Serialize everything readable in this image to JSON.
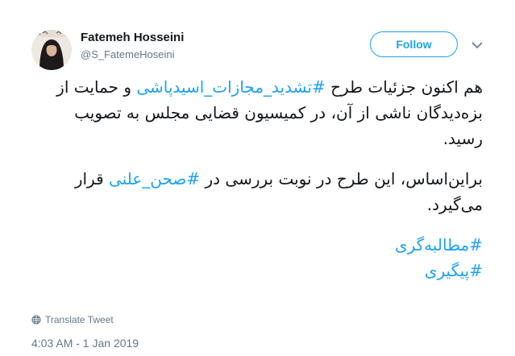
{
  "tweet": {
    "author_name": "Fatemeh Hosseini",
    "author_handle": "@S_FatemeHoseini",
    "follow_label": "Follow",
    "paragraph1": {
      "pre": "هم اکنون جزئیات طرح ",
      "hashtag": "#تشدید_مجازات_اسیدپاشی",
      "post": " و حمایت از بزه‌دیدگان ناشی از آن، در کمیسیون قضایی مجلس به تصویب رسید."
    },
    "paragraph2": {
      "pre": "براین‌اساس، این طرح در نوبت بررسی در ",
      "hashtag": "#صحن_علنی",
      "post": " قرار می‌گیرد."
    },
    "hashtags_end": [
      "#مطالبه‌گری",
      "#پیگیری"
    ],
    "translate_label": "Translate Tweet",
    "timestamp": "4:03 AM - 1 Jan 2019"
  },
  "colors": {
    "accent": "#1da1f2",
    "secondary_text": "#657786",
    "primary_text": "#14171a"
  },
  "icons": {
    "menu": "chevron-down-icon",
    "translate": "globe-icon"
  }
}
